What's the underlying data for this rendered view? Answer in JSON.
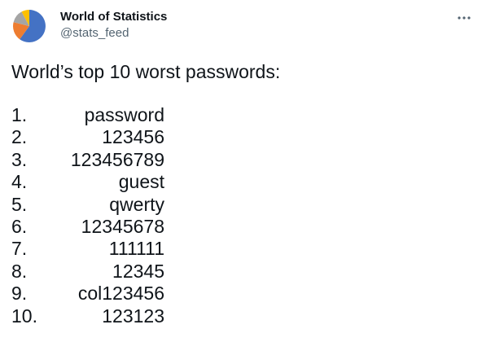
{
  "author": {
    "name": "World of Statistics",
    "handle": "@stats_feed",
    "avatar_icon": "pie-chart-avatar-icon",
    "avatar_colors": [
      "#4472c4",
      "#ed7d31",
      "#a5a5a5",
      "#ffc000"
    ]
  },
  "menu": {
    "icon": "more-dots-icon"
  },
  "tweet": {
    "heading": "World’s top 10 worst passwords:",
    "passwords": [
      {
        "rank": "1.",
        "password": "password"
      },
      {
        "rank": "2.",
        "password": "123456"
      },
      {
        "rank": "3.",
        "password": "123456789"
      },
      {
        "rank": "4.",
        "password": "guest"
      },
      {
        "rank": "5.",
        "password": "qwerty"
      },
      {
        "rank": "6.",
        "password": "12345678"
      },
      {
        "rank": "7.",
        "password": "111111"
      },
      {
        "rank": "8.",
        "password": "12345"
      },
      {
        "rank": "9.",
        "password": "col123456"
      },
      {
        "rank": "10.",
        "password": "123123"
      }
    ]
  }
}
